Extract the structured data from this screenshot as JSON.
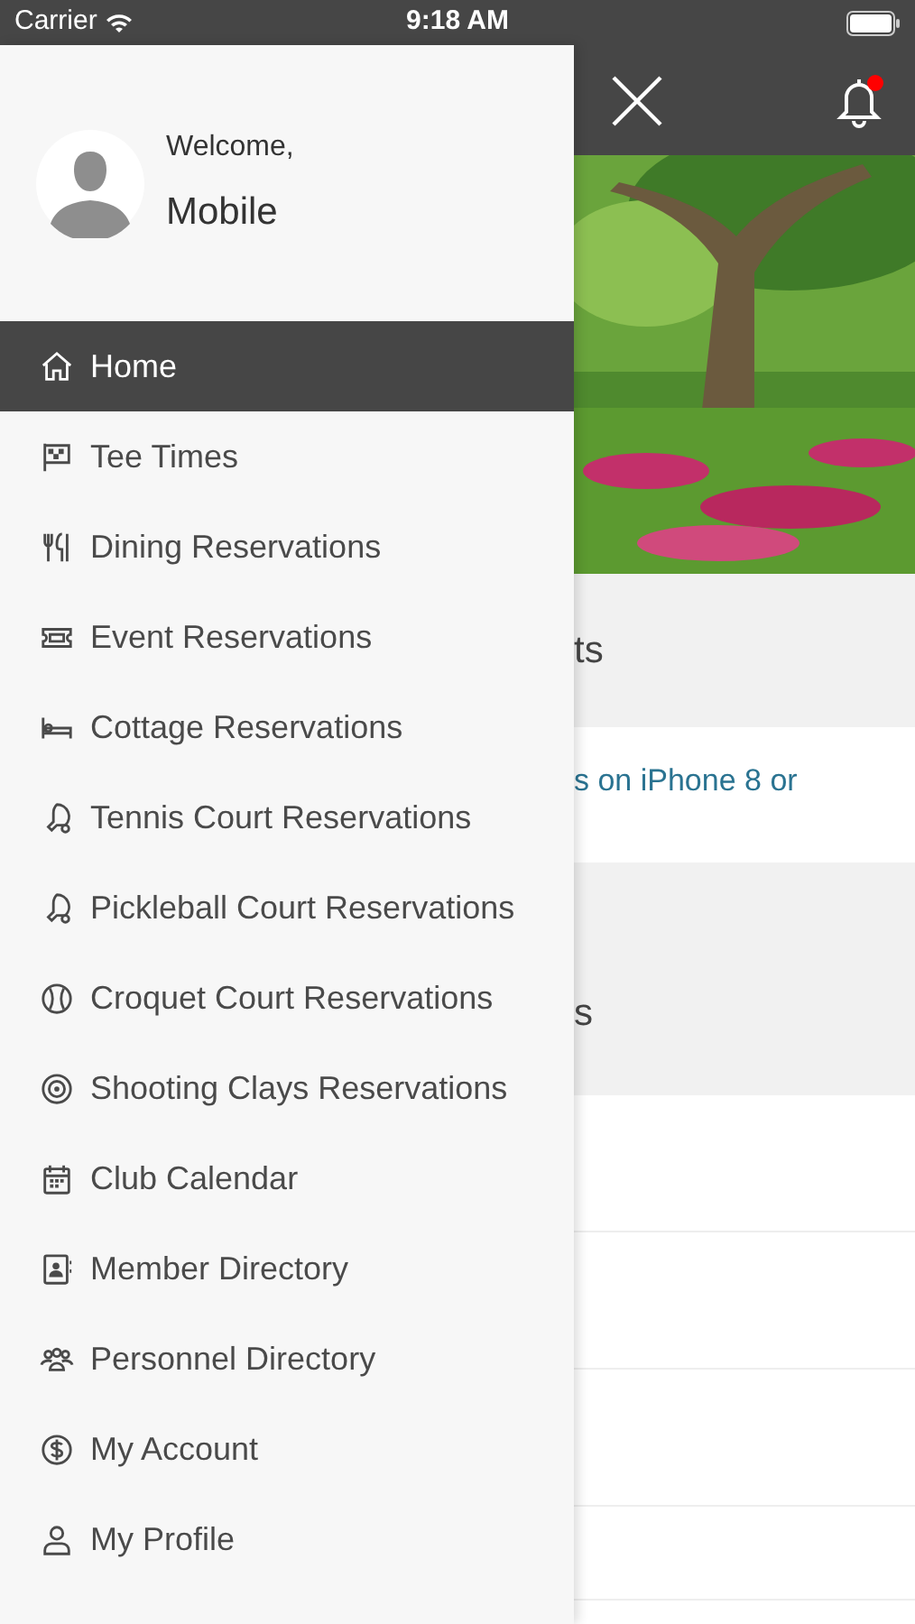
{
  "status_bar": {
    "carrier": "Carrier",
    "time": "9:18 AM"
  },
  "drawer": {
    "greeting": "Welcome,",
    "user_name": "Mobile",
    "items": [
      {
        "label": "Home",
        "selected": true
      },
      {
        "label": "Tee Times",
        "selected": false
      },
      {
        "label": "Dining Reservations",
        "selected": false
      },
      {
        "label": "Event Reservations",
        "selected": false
      },
      {
        "label": "Cottage Reservations",
        "selected": false
      },
      {
        "label": "Tennis Court Reservations",
        "selected": false
      },
      {
        "label": "Pickleball Court Reservations",
        "selected": false
      },
      {
        "label": "Croquet Court Reservations",
        "selected": false
      },
      {
        "label": "Shooting Clays Reservations",
        "selected": false
      },
      {
        "label": "Club Calendar",
        "selected": false
      },
      {
        "label": "Member Directory",
        "selected": false
      },
      {
        "label": "Personnel Directory",
        "selected": false
      },
      {
        "label": "My Account",
        "selected": false
      },
      {
        "label": "My Profile",
        "selected": false
      }
    ]
  },
  "main": {
    "notification_badge": true,
    "section_1_heading": "ts",
    "section_1_link": "s on iPhone 8 or",
    "section_2_heading": "s"
  }
}
